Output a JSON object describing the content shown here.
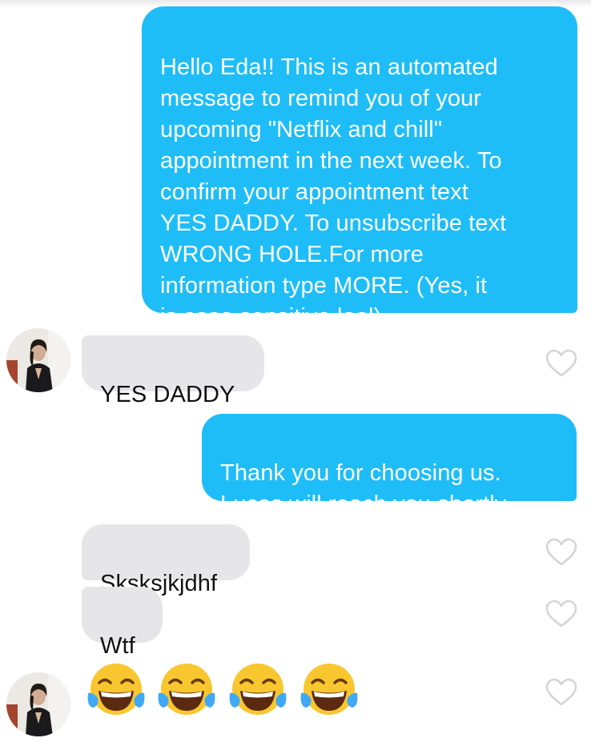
{
  "conversation": {
    "messages": [
      {
        "direction": "outgoing",
        "text": "Hello Eda!! This is an automated\nmessage to remind you of your\nupcoming \"Netflix and chill\"\nappointment in the next week. To\nconfirm your appointment text\nYES DADDY. To unsubscribe text\nWRONG HOLE.For more\ninformation type MORE. (Yes, it\nis case sensitive lool)"
      },
      {
        "direction": "incoming",
        "text": "YES DADDY"
      },
      {
        "direction": "outgoing",
        "text": "Thank you for choosing us.\nLucas will reach you shortly."
      },
      {
        "direction": "incoming",
        "text": "Sksksjkjdhf"
      },
      {
        "direction": "incoming",
        "text": "Wtf"
      },
      {
        "direction": "incoming",
        "emoji": [
          "face-with-tears-of-joy",
          "face-with-tears-of-joy",
          "face-with-tears-of-joy",
          "face-with-tears-of-joy"
        ]
      }
    ]
  },
  "icons": {
    "like": "heart-outline-icon",
    "avatar": "contact-avatar"
  },
  "colors": {
    "outgoing_bubble": "#1ebdf7",
    "incoming_bubble": "#e6e6e9",
    "heart_outline": "#d5d5d8"
  }
}
